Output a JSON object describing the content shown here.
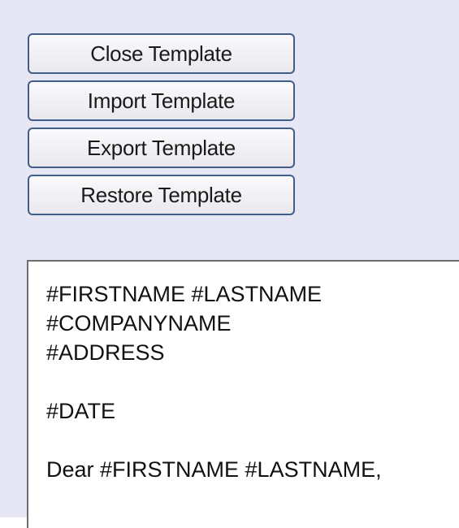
{
  "toolbar": {
    "close_label": "Close Template",
    "import_label": "Import Template",
    "export_label": "Export Template",
    "restore_label": "Restore Template"
  },
  "editor": {
    "content": "#FIRSTNAME #LASTNAME\n#COMPANYNAME\n#ADDRESS\n\n#DATE\n\nDear #FIRSTNAME #LASTNAME,"
  },
  "colors": {
    "panel_background": "#e6e6f5",
    "button_border": "#3f5e8a",
    "editor_background": "#ffffff"
  }
}
